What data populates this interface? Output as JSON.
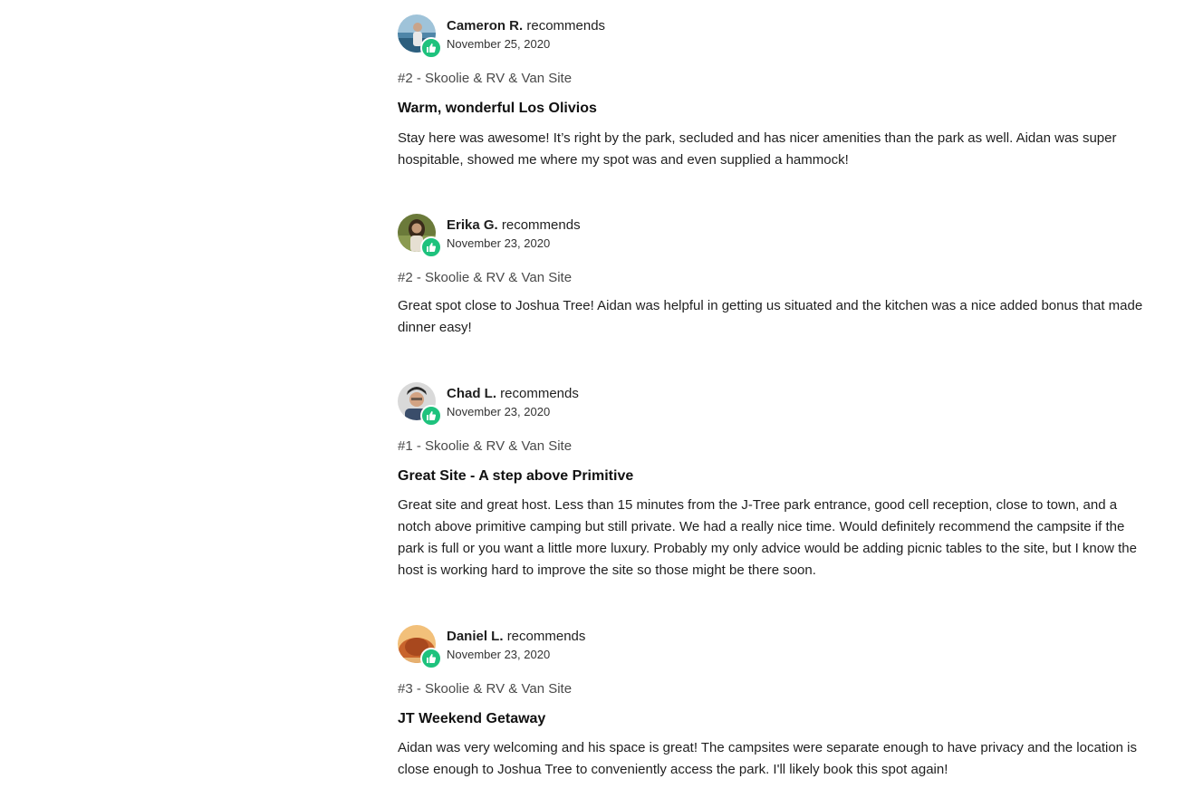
{
  "colors": {
    "badge_green": "#1ec27d",
    "text": "#1f1f1f",
    "muted": "#4a4a4a"
  },
  "reviews": [
    {
      "reviewer": "Cameron R.",
      "action": "recommends",
      "date": "November 25, 2020",
      "site": "#2 - Skoolie & RV & Van Site",
      "title": "Warm, wonderful Los Olivios",
      "body": "Stay here was awesome! It’s right by the park, secluded and has nicer amenities than the park as well. Aidan was super hospitable, showed me where my spot was and even supplied a hammock!",
      "badge_icon": "thumbs-up-icon"
    },
    {
      "reviewer": "Erika G.",
      "action": "recommends",
      "date": "November 23, 2020",
      "site": "#2 - Skoolie & RV & Van Site",
      "title": "",
      "body": "Great spot close to Joshua Tree! Aidan was helpful in getting us situated and the kitchen was a nice added bonus that made dinner easy!",
      "badge_icon": "thumbs-up-icon"
    },
    {
      "reviewer": "Chad L.",
      "action": "recommends",
      "date": "November 23, 2020",
      "site": "#1 - Skoolie & RV & Van Site",
      "title": "Great Site - A step above Primitive",
      "body": "Great site and great host. Less than 15 minutes from the J-Tree park entrance, good cell reception, close to town, and a notch above primitive camping but still private. We had a really nice time. Would definitely recommend the campsite if the park is full or you want a little more luxury. Probably my only advice would be adding picnic tables to the site, but I know the host is working hard to improve the site so those might be there soon.",
      "badge_icon": "thumbs-up-icon"
    },
    {
      "reviewer": "Daniel L.",
      "action": "recommends",
      "date": "November 23, 2020",
      "site": "#3 - Skoolie & RV & Van Site",
      "title": "JT Weekend Getaway",
      "body": "Aidan was very welcoming and his space is great! The campsites were separate enough to have privacy and the location is close enough to Joshua Tree to conveniently access the park. I'll likely book this spot again!",
      "badge_icon": "thumbs-up-icon"
    }
  ]
}
